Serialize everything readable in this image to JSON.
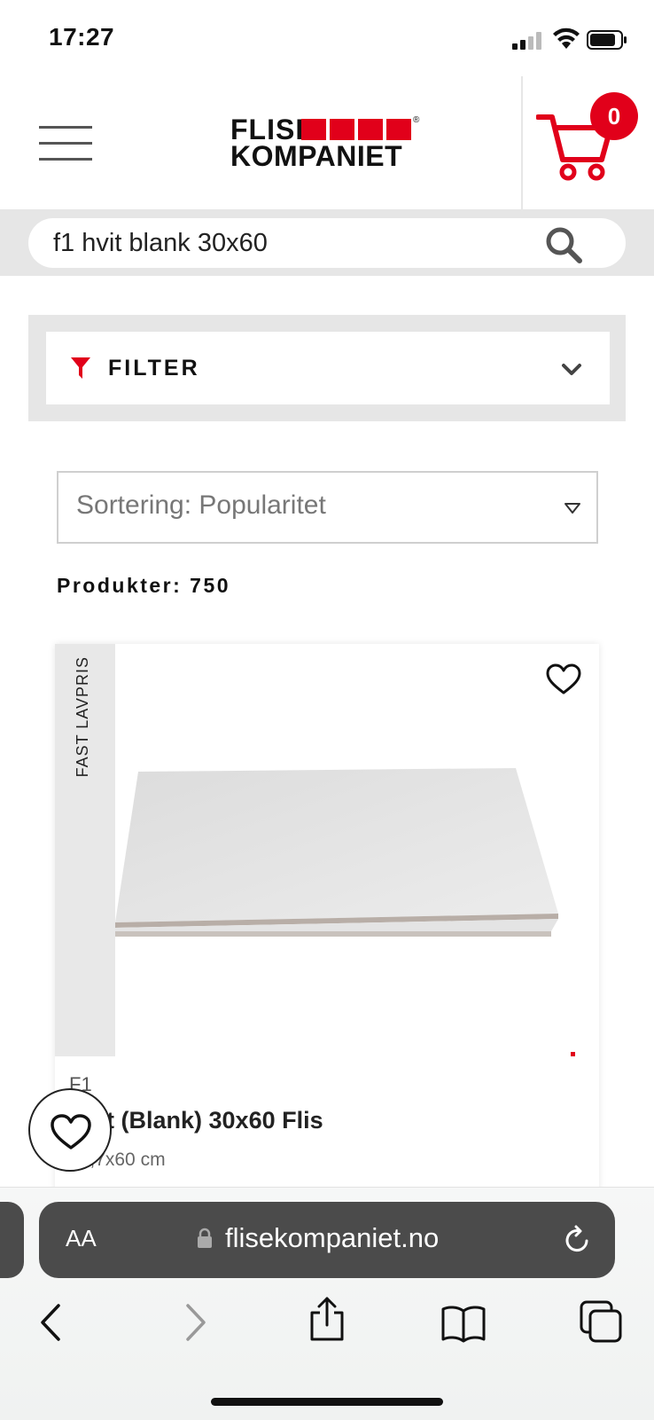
{
  "status_bar": {
    "time": "17:27"
  },
  "header": {
    "logo_line1": "FLISE",
    "logo_line2": "KOMPANIET",
    "logo_mark": "®",
    "cart_count": "0",
    "brand_color": "#e1001a"
  },
  "search": {
    "value": "f1 hvit blank 30x60"
  },
  "filter": {
    "label": "FILTER"
  },
  "sort": {
    "label": "Sortering: Popularitet"
  },
  "results": {
    "count_label": "Produkter: 750"
  },
  "product": {
    "ribbon": "FAST LAVPRIS",
    "brand": "F1",
    "title": "Hvit (Blank) 30x60 Flis",
    "size": "29,7x60 cm"
  },
  "browser": {
    "aa_label": "AA",
    "url": "flisekompaniet.no"
  },
  "icons": [
    "signal-icon",
    "wifi-icon",
    "battery-icon",
    "hamburger-menu-icon",
    "cart-icon",
    "search-icon",
    "filter-funnel-icon",
    "chevron-down-icon",
    "caret-down-icon",
    "heart-icon",
    "lock-icon",
    "reload-icon",
    "back-icon",
    "forward-icon",
    "share-icon",
    "bookmarks-icon",
    "tabs-icon"
  ]
}
